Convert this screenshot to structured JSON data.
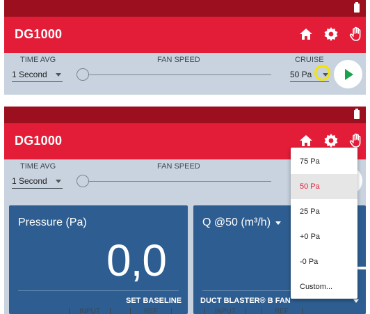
{
  "app": {
    "title": "DG1000"
  },
  "icons": {
    "home": "home-icon",
    "settings": "gear-icon",
    "hand": "hand-icon",
    "battery": "battery-icon",
    "play": "play-icon"
  },
  "colors": {
    "status_bar": "#9b0f1f",
    "app_bar": "#e31d38",
    "panel": "#2e5e91",
    "play": "#16a34a",
    "highlight": "#f5e400"
  },
  "controls": {
    "time_avg_label": "TIME AVG",
    "time_avg_value": "1 Second",
    "fan_speed_label": "FAN SPEED",
    "fan_speed_level": 0,
    "cruise_label": "CRUISE",
    "cruise_value": "50 Pa"
  },
  "panels": {
    "pressure": {
      "title": "Pressure (Pa)",
      "value": "0,0",
      "footer": "SET BASELINE"
    },
    "flow": {
      "title": "Q @50 (m³/h)",
      "footer": "DUCT BLASTER® B FAN"
    }
  },
  "bottom_tabs": [
    {
      "label": "INPUT"
    },
    {
      "label": "REF"
    },
    {
      "label": "INPUT"
    },
    {
      "label": "REF"
    }
  ],
  "cruise_menu": {
    "items": [
      {
        "label": "75 Pa"
      },
      {
        "label": "50 Pa",
        "selected": true
      },
      {
        "label": "25 Pa"
      },
      {
        "label": "+0 Pa"
      },
      {
        "label": "-0 Pa"
      },
      {
        "label": "Custom..."
      }
    ]
  }
}
